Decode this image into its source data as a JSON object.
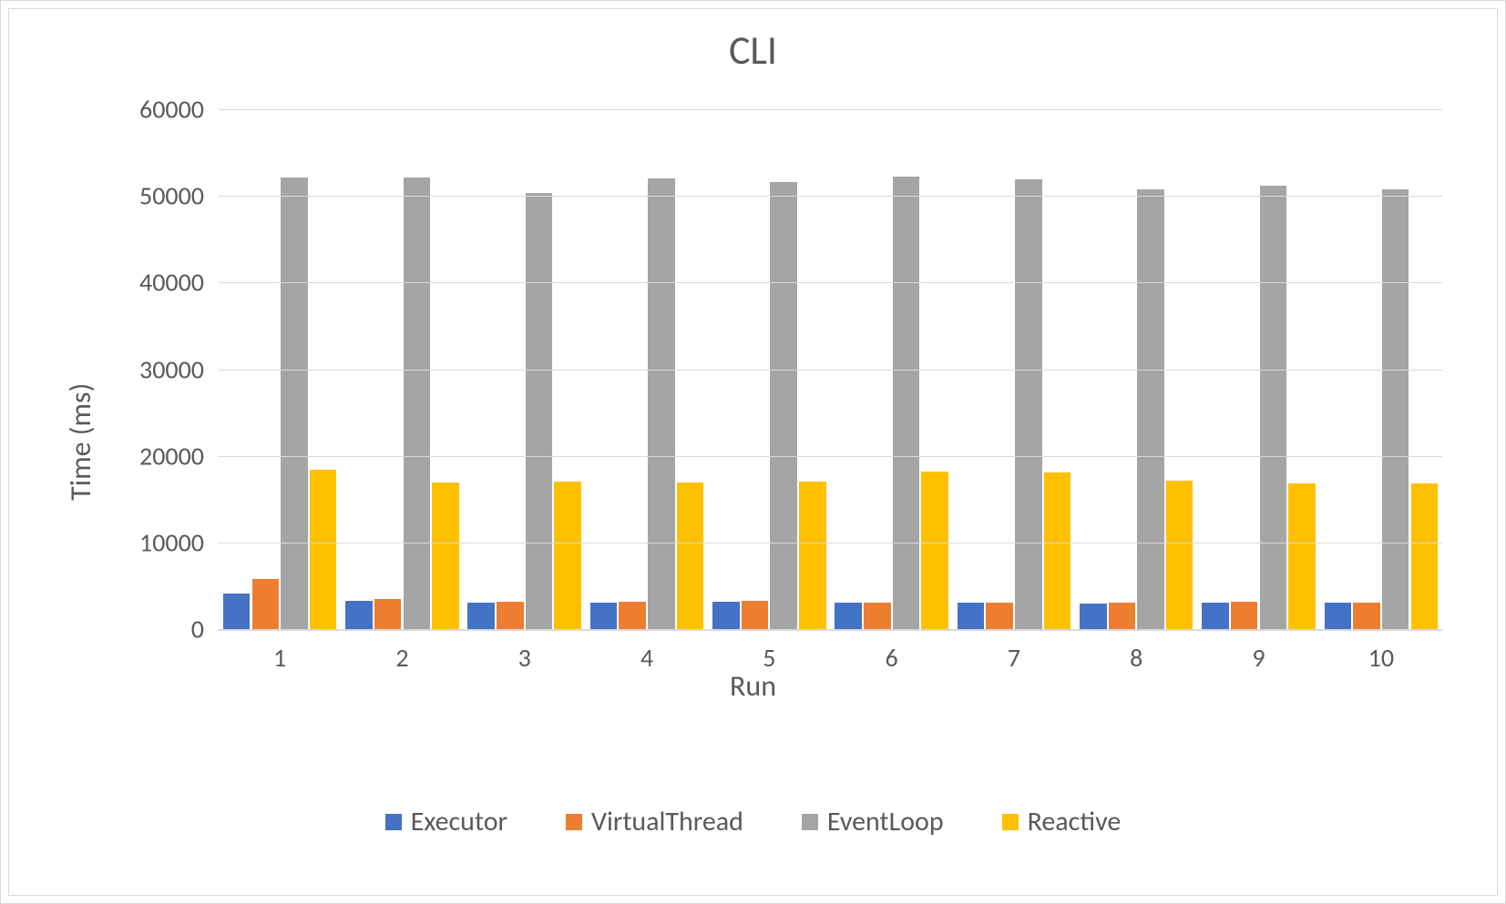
{
  "chart_data": {
    "type": "bar",
    "title": "CLI",
    "xlabel": "Run",
    "ylabel": "Time (ms)",
    "ylim": [
      0,
      60000
    ],
    "yticks": [
      0,
      10000,
      20000,
      30000,
      40000,
      50000,
      60000
    ],
    "categories": [
      "1",
      "2",
      "3",
      "4",
      "5",
      "6",
      "7",
      "8",
      "9",
      "10"
    ],
    "series": [
      {
        "name": "Executor",
        "color": "#4472C4",
        "values": [
          4100,
          3300,
          3100,
          3100,
          3200,
          3100,
          3100,
          2900,
          3000,
          3100
        ]
      },
      {
        "name": "VirtualThread",
        "color": "#ED7D31",
        "values": [
          5800,
          3500,
          3200,
          3200,
          3300,
          3100,
          3100,
          3100,
          3200,
          3100
        ]
      },
      {
        "name": "EventLoop",
        "color": "#A5A5A5",
        "values": [
          52100,
          52100,
          50300,
          52000,
          51600,
          52200,
          51900,
          50800,
          51200,
          50800
        ]
      },
      {
        "name": "Reactive",
        "color": "#FFC000",
        "values": [
          18400,
          16900,
          17000,
          16900,
          17000,
          18200,
          18100,
          17100,
          16800,
          16800
        ]
      }
    ],
    "legend_position": "bottom",
    "grid": true
  }
}
